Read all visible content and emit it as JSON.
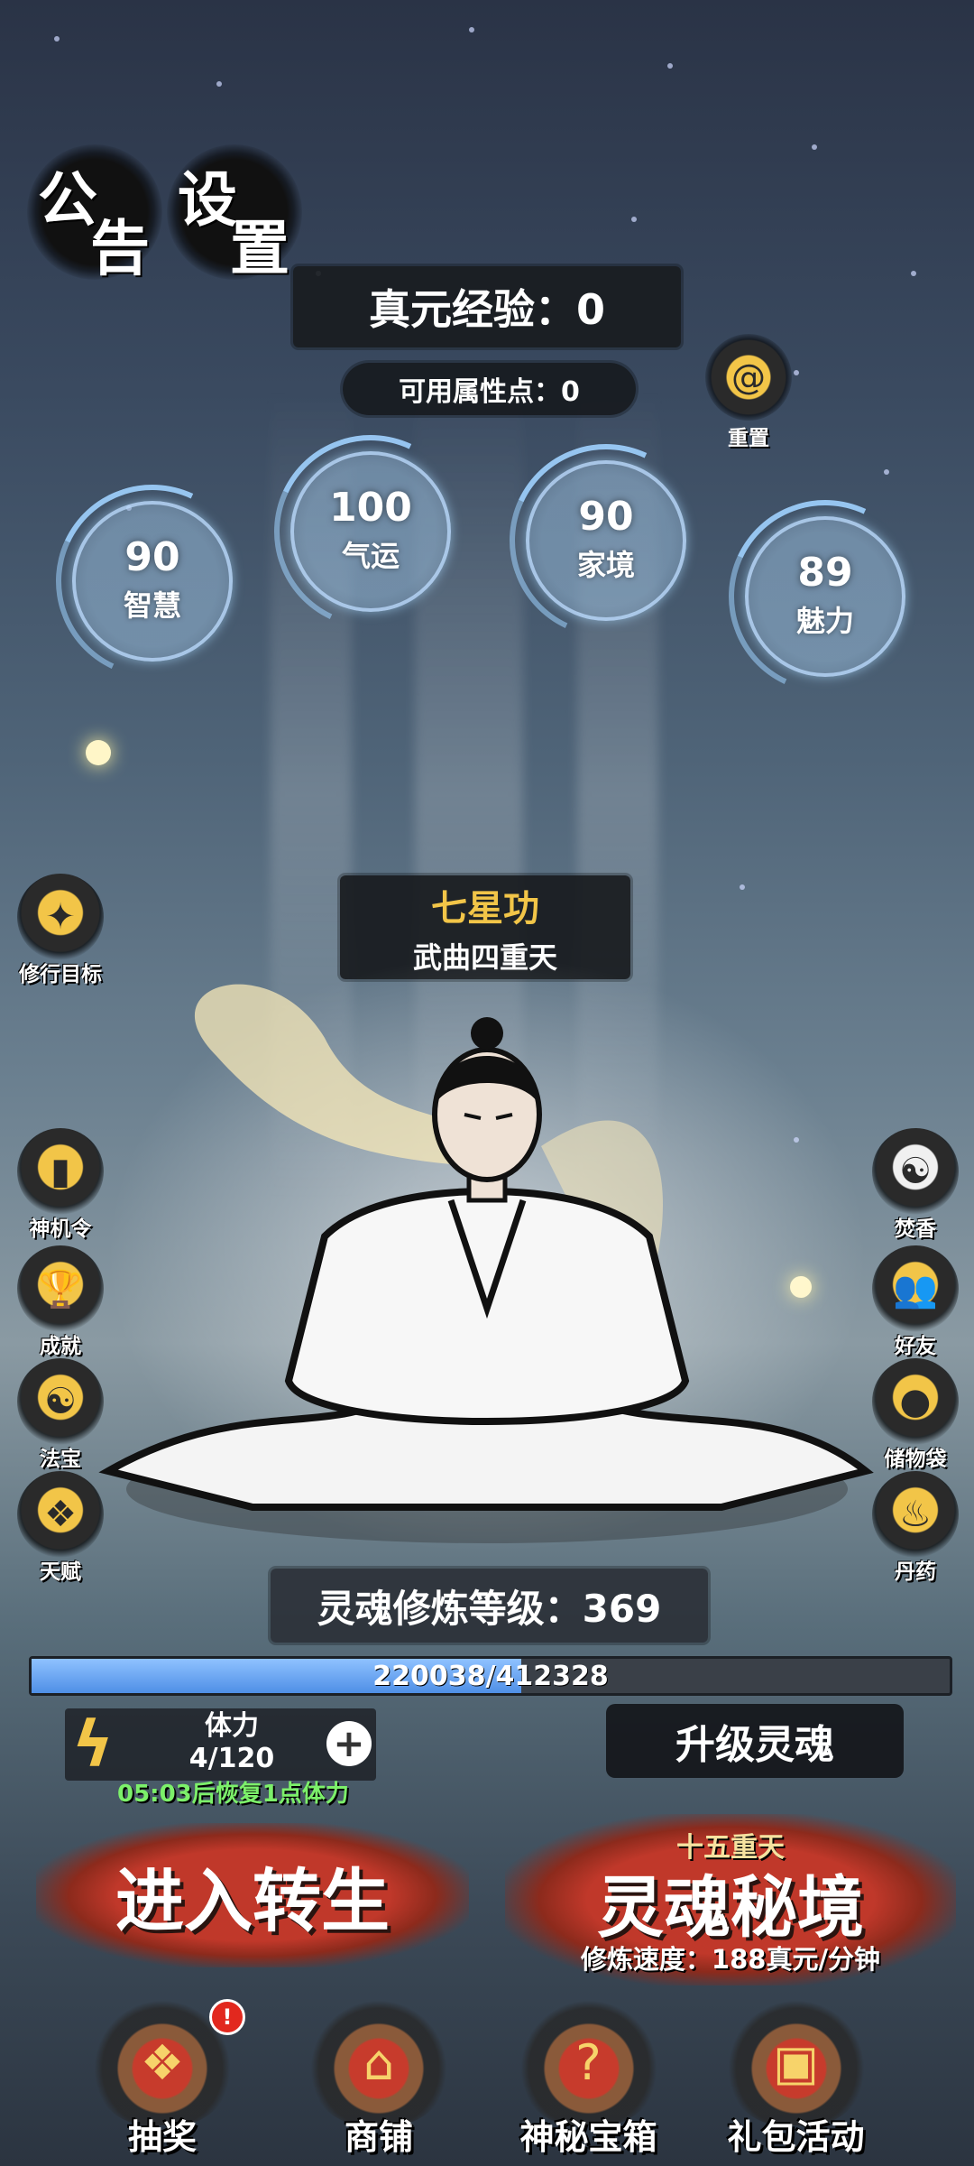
{
  "header": {
    "notice_btn": [
      "公",
      "告"
    ],
    "settings_btn": [
      "设",
      "置"
    ],
    "exp_label": "真元经验：0",
    "attr_points_label": "可用属性点：0",
    "reset_label": "重置"
  },
  "stats": [
    {
      "value": "90",
      "label": "智慧"
    },
    {
      "value": "100",
      "label": "气运"
    },
    {
      "value": "90",
      "label": "家境"
    },
    {
      "value": "89",
      "label": "魅力"
    }
  ],
  "left_icons": [
    {
      "label": "修行目标",
      "icon": "goal-icon"
    },
    {
      "label": "神机令",
      "icon": "token-icon"
    },
    {
      "label": "成就",
      "icon": "trophy-icon"
    },
    {
      "label": "法宝",
      "icon": "taiji-icon"
    },
    {
      "label": "天赋",
      "icon": "talent-icon"
    }
  ],
  "right_icons": [
    {
      "label": "焚香",
      "icon": "incense-icon"
    },
    {
      "label": "好友",
      "icon": "friends-icon"
    },
    {
      "label": "储物袋",
      "icon": "bag-icon"
    },
    {
      "label": "丹药",
      "icon": "pill-gourd-icon"
    }
  ],
  "technique": {
    "name": "七星功",
    "stage": "武曲四重天"
  },
  "soul": {
    "level_label": "灵魂修炼等级：369",
    "progress_current": "220038",
    "progress_total": "412328",
    "progress_fraction": 0.5337,
    "progress_separator": "/"
  },
  "stamina": {
    "title": "体力",
    "value": "4/120",
    "recover_text": "05:03后恢复1点体力",
    "plus_icon": "plus-icon"
  },
  "upgrade_btn": "升级灵魂",
  "actions": {
    "reincarnate": "进入转生",
    "realm_sub": "十五重天",
    "realm": "灵魂秘境",
    "speed": "修炼速度：188真元/分钟"
  },
  "bottom_nav": [
    {
      "label": "抽奖",
      "icon": "lottery-icon",
      "badge": "!"
    },
    {
      "label": "商铺",
      "icon": "shop-icon"
    },
    {
      "label": "神秘宝箱",
      "icon": "mystery-chest-icon"
    },
    {
      "label": "礼包活动",
      "icon": "gift-pack-icon"
    }
  ],
  "colors": {
    "accent_gold": "#f2c548",
    "progress_blue": "#4f8fe6",
    "recover_green": "#7cf06a",
    "brush_red": "#b2321f"
  }
}
